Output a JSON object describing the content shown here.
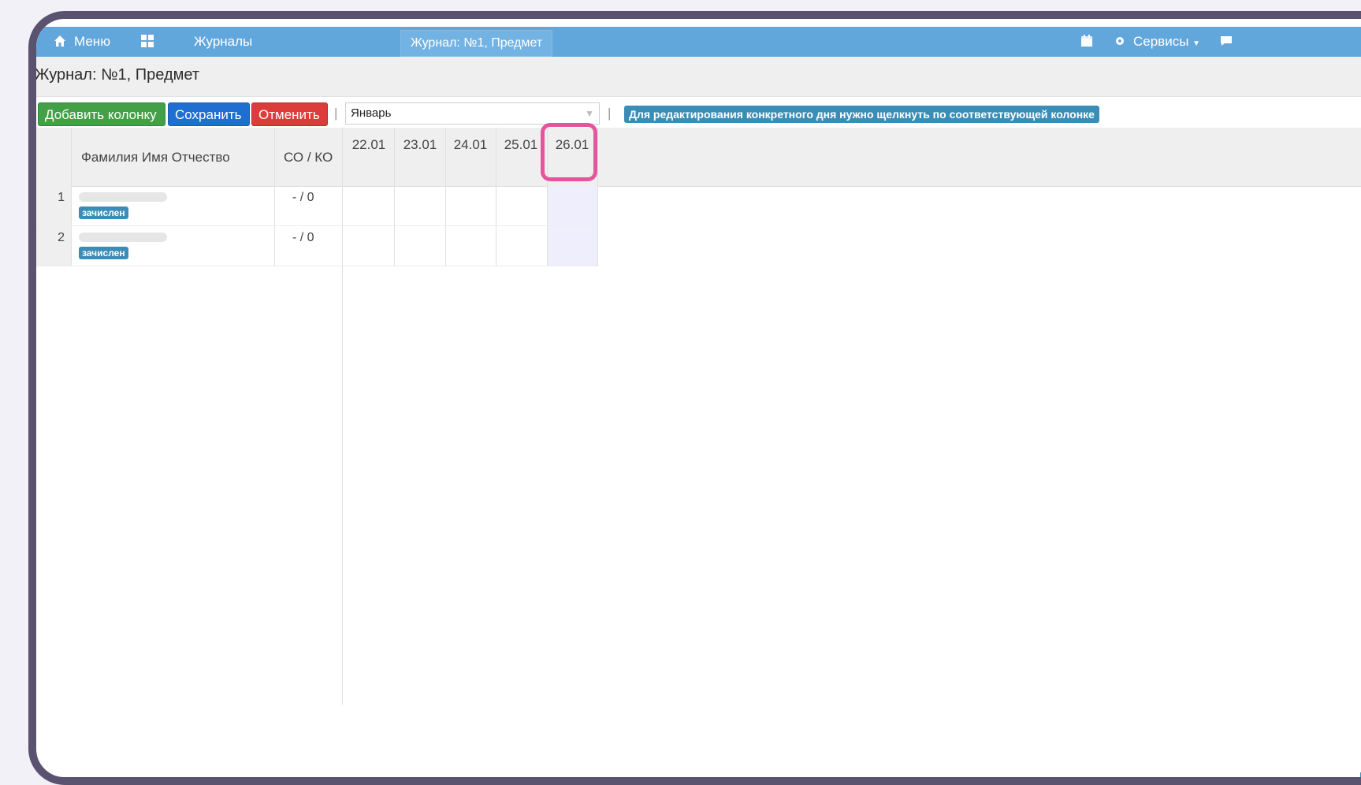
{
  "nav": {
    "menu": "Меню",
    "journals": "Журналы",
    "crumb": "Журнал: №1, Предмет",
    "services": "Сервисы"
  },
  "page": {
    "title": "Журнал: №1, Предмет"
  },
  "toolbar": {
    "add_column": "Добавить колонку",
    "save": "Сохранить",
    "cancel": "Отменить",
    "month": "Январь",
    "hint": "Для редактирования конкретного дня нужно щелкнуть по соответствующей колонке",
    "separator": "|"
  },
  "table": {
    "col_name": "Фамилия Имя Отчество",
    "col_score": "СО / КО",
    "dates": [
      "22.01",
      "23.01",
      "24.01",
      "25.01",
      "26.01"
    ],
    "highlighted_date": "26.01",
    "rows": [
      {
        "num": "1",
        "status": "зачислен",
        "score": "- / 0"
      },
      {
        "num": "2",
        "status": "зачислен",
        "score": "- / 0"
      }
    ]
  },
  "colors": {
    "nav": "#62a7dc",
    "add": "#43a047",
    "save": "#1e6fd0",
    "cancel": "#dc3d3a",
    "badge": "#3a8db7",
    "highlight": "#e5559e"
  }
}
